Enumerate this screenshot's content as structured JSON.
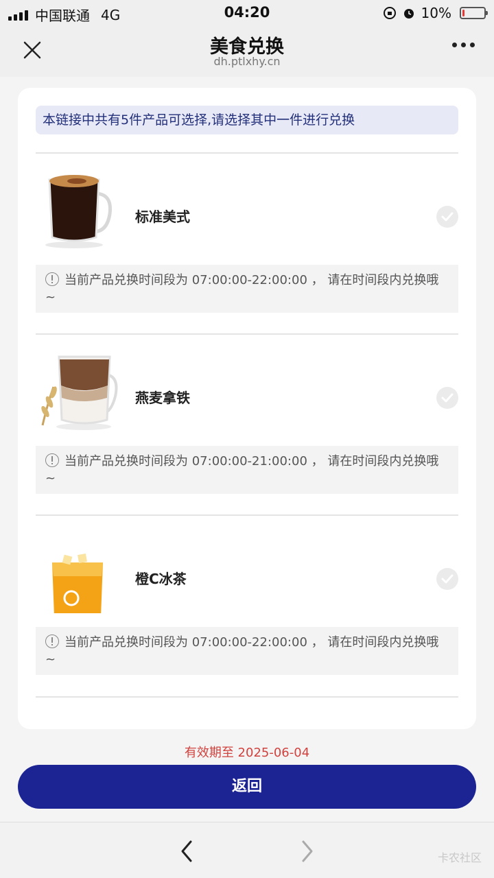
{
  "status_bar": {
    "carrier": "中国联通",
    "network": "4G",
    "time": "04:20",
    "battery": "10%",
    "battery_level": 0.1
  },
  "nav": {
    "title": "美食兑换",
    "subtitle": "dh.ptlxhy.cn",
    "close_icon": "close-icon",
    "more_icon": "more-dots-icon"
  },
  "notice": "本链接中共有5件产品可选择,请选择其中一件进行兑换",
  "products": [
    {
      "name": "标准美式",
      "hint": "当前产品兑换时间段为 07:00:00-22:00:00 ， 请在时间段内兑换哦~",
      "selected": false
    },
    {
      "name": "燕麦拿铁",
      "hint": "当前产品兑换时间段为 07:00:00-21:00:00 ， 请在时间段内兑换哦~",
      "selected": false
    },
    {
      "name": "橙C冰茶",
      "hint": "当前产品兑换时间段为 07:00:00-22:00:00 ， 请在时间段内兑换哦~",
      "selected": false
    }
  ],
  "validity": "有效期至 2025-06-04",
  "return_button": "返回",
  "watermark": "卡农社区",
  "colors": {
    "primary": "#1c2392",
    "notice_bg": "#e8e9f6",
    "notice_text": "#23307a",
    "validity_text": "#d0423d"
  }
}
